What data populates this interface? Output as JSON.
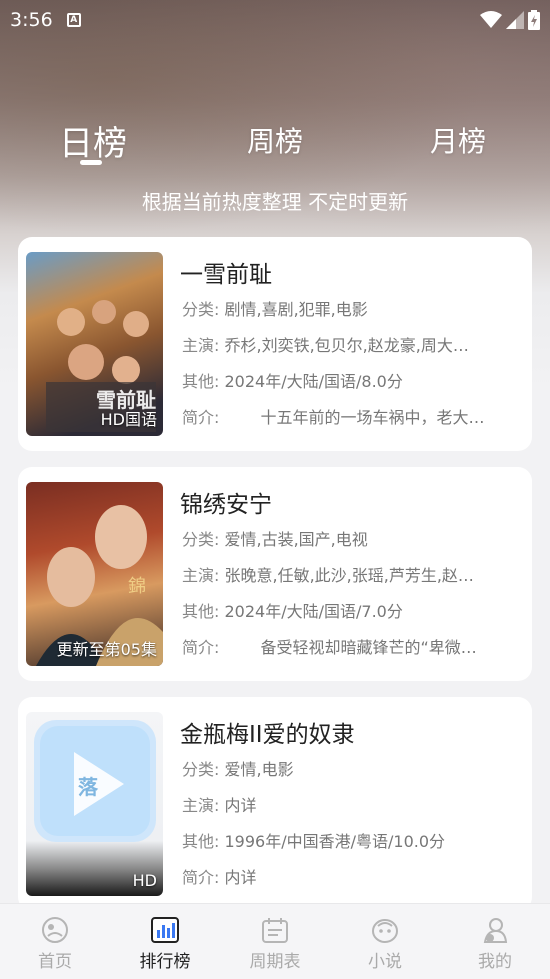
{
  "status_bar": {
    "time": "3:56",
    "notif_glyph": "A"
  },
  "tabs": [
    {
      "label": "日榜",
      "active": true
    },
    {
      "label": "周榜",
      "active": false
    },
    {
      "label": "月榜",
      "active": false
    }
  ],
  "subtitle": "根据当前热度整理 不定时更新",
  "labels": {
    "category": "分类:",
    "cast": "主演:",
    "other": "其他:",
    "intro": "简介:"
  },
  "items": [
    {
      "title": "一雪前耻",
      "category": "剧情,喜剧,犯罪,电影",
      "cast": "乔杉,刘奕铁,包贝尔,赵龙豪,周大…",
      "other": "2024年/大陆/国语/8.0分",
      "intro": "十五年前的一场车祸中，老大…",
      "badge": "HD国语"
    },
    {
      "title": "锦绣安宁",
      "category": "爱情,古装,国产,电视",
      "cast": "张晚意,任敏,此沙,张瑶,芦芳生,赵…",
      "other": "2024年/大陆/国语/7.0分",
      "intro": "备受轻视却暗藏锋芒的“卑微…",
      "badge": "更新至第05集"
    },
    {
      "title": "金瓶梅II爱的奴隶",
      "category": "爱情,电影",
      "cast": "内详",
      "other": "1996年/中国香港/粤语/10.0分",
      "intro": "内详",
      "badge": "HD"
    }
  ],
  "bottom_nav": [
    {
      "label": "首页",
      "icon": "home-icon",
      "active": false
    },
    {
      "label": "排行榜",
      "icon": "ranking-icon",
      "active": true
    },
    {
      "label": "周期表",
      "icon": "calendar-icon",
      "active": false
    },
    {
      "label": "小说",
      "icon": "novel-icon",
      "active": false
    },
    {
      "label": "我的",
      "icon": "profile-icon",
      "active": false
    }
  ],
  "colors": {
    "accent": "#3a78f2",
    "text_dark": "#222222",
    "text_gray": "#777777",
    "nav_inactive": "#aaaaaa"
  }
}
